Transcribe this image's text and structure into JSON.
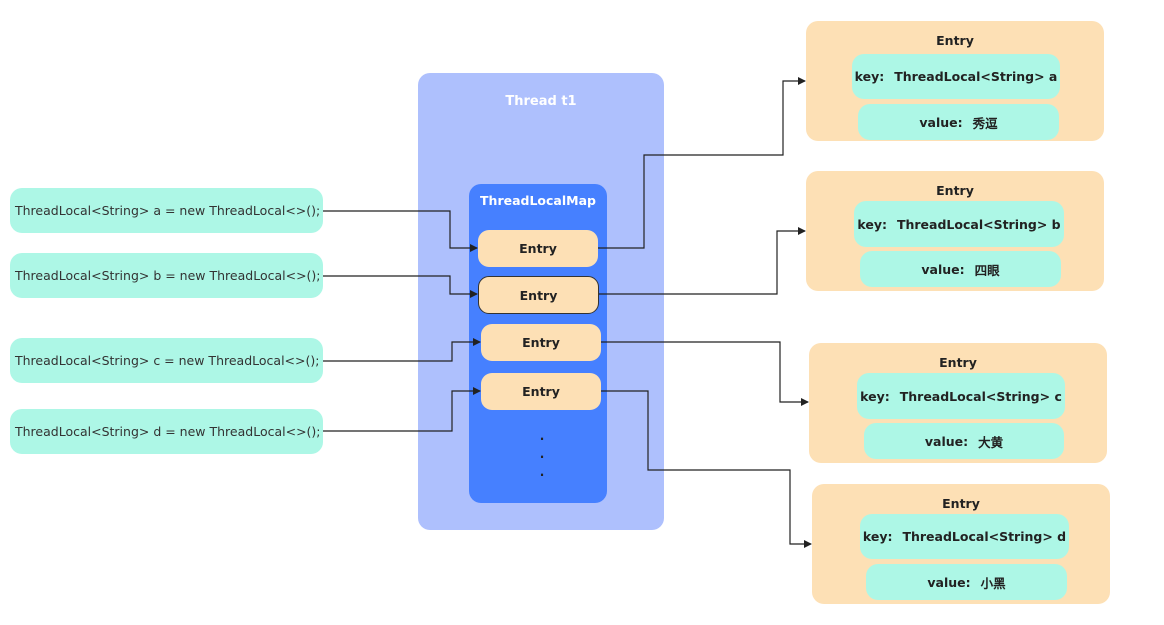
{
  "declarations": [
    {
      "text": "ThreadLocal<String> a = new ThreadLocal<>();"
    },
    {
      "text": "ThreadLocal<String> b = new ThreadLocal<>();"
    },
    {
      "text": "ThreadLocal<String> c = new ThreadLocal<>();"
    },
    {
      "text": "ThreadLocal<String> d = new ThreadLocal<>();"
    }
  ],
  "thread": {
    "title": "Thread  t1",
    "map": {
      "title": "ThreadLocalMap",
      "entries": [
        "Entry",
        "Entry",
        "Entry",
        "Entry"
      ],
      "ellipsis": [
        "·",
        "·",
        "·"
      ]
    }
  },
  "entry_details": [
    {
      "title": "Entry",
      "key_label": "key:",
      "key": "ThreadLocal<String> a",
      "value_label": "value:",
      "value": "秀逗"
    },
    {
      "title": "Entry",
      "key_label": "key:",
      "key": "ThreadLocal<String> b",
      "value_label": "value:",
      "value": "四眼"
    },
    {
      "title": "Entry",
      "key_label": "key:",
      "key": "ThreadLocal<String> c",
      "value_label": "value:",
      "value": "大黄"
    },
    {
      "title": "Entry",
      "key_label": "key:",
      "key": "ThreadLocal<String> d",
      "value_label": "value:",
      "value": "小黑"
    }
  ],
  "colors": {
    "declaration_fill": "#adf7e6",
    "thread_fill": "#aec0fd",
    "map_fill": "#4680ff",
    "entry_fill": "#fde0b5",
    "connector": "#222222"
  }
}
